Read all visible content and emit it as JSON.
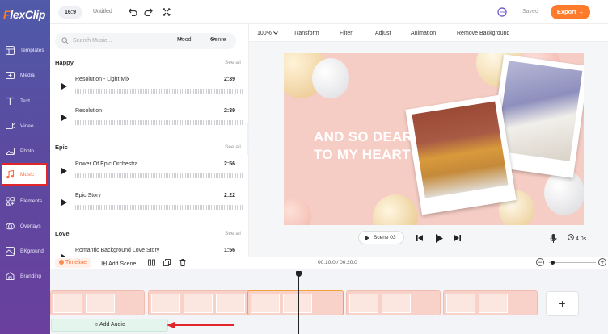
{
  "app": {
    "logo_prefix": "F",
    "logo_rest": "lexClip"
  },
  "sidebar": {
    "items": [
      {
        "label": "Templates",
        "icon": "templates-icon"
      },
      {
        "label": "Media",
        "icon": "media-icon"
      },
      {
        "label": "Text",
        "icon": "text-icon"
      },
      {
        "label": "Video",
        "icon": "video-icon"
      },
      {
        "label": "Photo",
        "icon": "photo-icon"
      },
      {
        "label": "Music",
        "icon": "music-icon",
        "active": true
      },
      {
        "label": "Elements",
        "icon": "elements-icon"
      },
      {
        "label": "Overlays",
        "icon": "overlays-icon"
      },
      {
        "label": "BKground",
        "icon": "background-icon"
      },
      {
        "label": "Branding",
        "icon": "branding-icon"
      }
    ]
  },
  "topbar": {
    "ratio": "16:9",
    "title": "Untitled",
    "saved": "Saved",
    "export": "Export →"
  },
  "music": {
    "search_placeholder": "Search Music...",
    "mood": "Mood",
    "genre": "Genre",
    "see_all": "See all",
    "categories": [
      {
        "name": "Happy",
        "tracks": [
          {
            "title": "Resolution - Light Mix",
            "duration": "2:39"
          },
          {
            "title": "Resolution",
            "duration": "2:39"
          }
        ]
      },
      {
        "name": "Epic",
        "tracks": [
          {
            "title": "Power Of Epic Orchestra",
            "duration": "2:56"
          },
          {
            "title": "Epic Story",
            "duration": "2:22"
          }
        ]
      },
      {
        "name": "Love",
        "tracks": [
          {
            "title": "Romantic Background Love Story",
            "duration": "1:56"
          }
        ]
      }
    ]
  },
  "editor": {
    "zoom": "100%",
    "tools": [
      "Transform",
      "Filter",
      "Adjust",
      "Animation",
      "Remove Background"
    ],
    "video_text": [
      "AND SO DEAR",
      "TO MY HEART"
    ],
    "scene": "Scene 03",
    "duration": "4.0s"
  },
  "timeline": {
    "label": "Timeline",
    "add_scene": "Add Scene",
    "time": "00:10.0 / 00:20.0",
    "add_audio": "Add Audio",
    "plus": "+"
  },
  "colors": {
    "accent": "#ff7b2c",
    "sidebar": "#5b4aa0",
    "canvas_bg": "#f6cdc4",
    "highlight": "#e0262a"
  }
}
